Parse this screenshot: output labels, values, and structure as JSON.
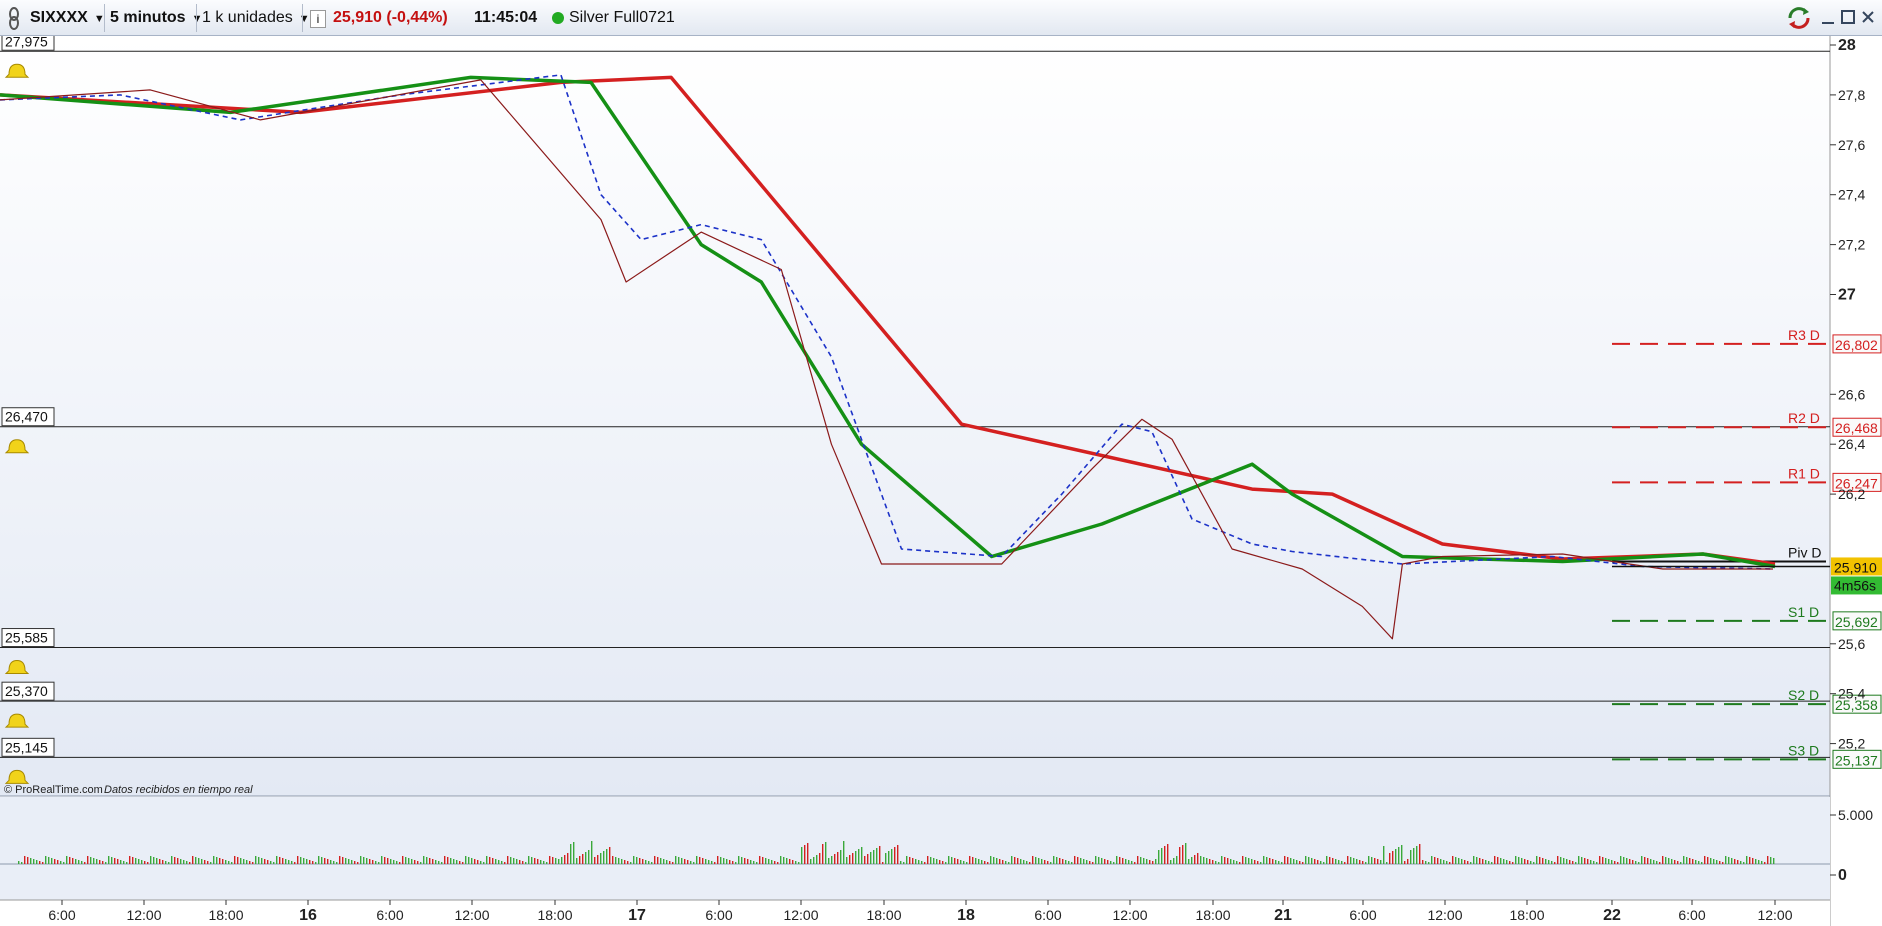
{
  "toolbar": {
    "symbol": "SIXXXX",
    "timeframe": "5 minutos",
    "units": "1 k unidades",
    "info_icon_label": "i",
    "price_change": "25,910 (-0,44%)",
    "time": "11:45:04",
    "status_text": "Silver Full0721",
    "status_color": "#22aa22",
    "window_icons": [
      "sync-icon",
      "minimize-icon",
      "maximize-icon",
      "close-icon"
    ]
  },
  "chart_data": {
    "type": "line",
    "title": "",
    "y_axis": {
      "ticks": [
        "28",
        "27,8",
        "27,6",
        "27,4",
        "27,2",
        "27",
        "26,6",
        "26,4",
        "26,2",
        "25,6",
        "25,4",
        "25,2"
      ],
      "bold_ticks": [
        "28",
        "27"
      ],
      "ylim": [
        25.1,
        28.05
      ]
    },
    "x_axis": {
      "labels": [
        "6:00",
        "12:00",
        "18:00",
        "16",
        "6:00",
        "12:00",
        "18:00",
        "17",
        "6:00",
        "12:00",
        "18:00",
        "18",
        "6:00",
        "12:00",
        "18:00",
        "21",
        "6:00",
        "12:00",
        "18:00",
        "22",
        "6:00",
        "12:00"
      ],
      "bold_labels": [
        "16",
        "17",
        "18",
        "21",
        "22"
      ],
      "day_boundaries": [
        "16",
        "17",
        "18",
        "21",
        "22"
      ]
    },
    "horizontal_alert_lines": [
      {
        "label": "27,975",
        "value": 27.975
      },
      {
        "label": "26,470",
        "value": 26.47
      },
      {
        "label": "25,585",
        "value": 25.585
      },
      {
        "label": "25,370",
        "value": 25.37
      },
      {
        "label": "25,145",
        "value": 25.145
      }
    ],
    "pivot_levels": [
      {
        "name": "R3 D",
        "value_label": "26,802",
        "value": 26.802,
        "color": "#d42020",
        "dash": true
      },
      {
        "name": "R2 D",
        "value_label": "26,468",
        "value": 26.468,
        "color": "#d42020",
        "dash": true
      },
      {
        "name": "R1 D",
        "value_label": "26,247",
        "value": 26.247,
        "color": "#d42020",
        "dash": true
      },
      {
        "name": "Piv D",
        "value_label": "",
        "value": 25.93,
        "color": "#111111",
        "dash": false
      },
      {
        "name": "S1 D",
        "value_label": "25,692",
        "value": 25.692,
        "color": "#1e7a1e",
        "dash": true
      },
      {
        "name": "S2 D",
        "value_label": "25,358",
        "value": 25.358,
        "color": "#1e7a1e",
        "dash": true
      },
      {
        "name": "S3 D",
        "value_label": "25,137",
        "value": 25.137,
        "color": "#1e7a1e",
        "dash": true
      }
    ],
    "current_price": {
      "label": "25,910",
      "value": 25.91,
      "countdown": "4m56s"
    },
    "series": [
      {
        "color": "#d42020",
        "x": [
          0,
          300,
          560,
          670,
          960,
          1250,
          1330,
          1440,
          1560,
          1700,
          1772
        ],
        "values": [
          27.8,
          27.73,
          27.85,
          27.87,
          26.48,
          26.22,
          26.2,
          26.0,
          25.94,
          25.96,
          25.92
        ]
      },
      {
        "color": "#159015",
        "x": [
          0,
          230,
          470,
          590,
          700,
          760,
          860,
          990,
          1100,
          1250,
          1290,
          1400,
          1560,
          1700,
          1772
        ],
        "values": [
          27.8,
          27.73,
          27.87,
          27.85,
          27.2,
          27.05,
          26.4,
          25.95,
          26.08,
          26.32,
          26.2,
          25.95,
          25.93,
          25.96,
          25.91
        ]
      },
      {
        "color": "#1c32c8",
        "dash": true,
        "x": [
          0,
          120,
          240,
          400,
          560,
          600,
          640,
          700,
          760,
          830,
          900,
          1000,
          1060,
          1120,
          1150,
          1190,
          1250,
          1290,
          1400,
          1550,
          1640,
          1770
        ],
        "values": [
          27.78,
          27.8,
          27.7,
          27.8,
          27.88,
          27.4,
          27.22,
          27.28,
          27.22,
          26.75,
          25.98,
          25.95,
          26.2,
          26.48,
          26.45,
          26.1,
          26.0,
          25.97,
          25.92,
          25.95,
          25.91,
          25.9
        ]
      },
      {
        "color": "#8b1a1a",
        "x": [
          0,
          150,
          260,
          480,
          600,
          625,
          700,
          780,
          830,
          880,
          1000,
          1090,
          1140,
          1170,
          1230,
          1300,
          1360,
          1390,
          1400,
          1440,
          1560,
          1660,
          1770
        ],
        "values": [
          27.78,
          27.82,
          27.7,
          27.86,
          27.3,
          27.05,
          27.25,
          27.1,
          26.4,
          25.92,
          25.92,
          26.3,
          26.5,
          26.42,
          25.98,
          25.9,
          25.75,
          25.62,
          25.92,
          25.95,
          25.96,
          25.9,
          25.9
        ]
      }
    ],
    "volume": {
      "ticks": [
        "5.000",
        "0"
      ],
      "color_up": "#3aa83a",
      "color_down": "#d42020"
    }
  },
  "footer": {
    "source_text": "© ProRealTime.com",
    "source_note": "Datos recibidos en tiempo real"
  },
  "colors": {
    "background_top": "#ffffff",
    "background_bottom": "#e3e9f4",
    "red_ma": "#d42020",
    "green_ma": "#159015",
    "blue_ma": "#1c32c8",
    "price_line": "#8b1a1a",
    "current_price_bg": "#f2c200",
    "countdown_bg": "#33bb33"
  }
}
